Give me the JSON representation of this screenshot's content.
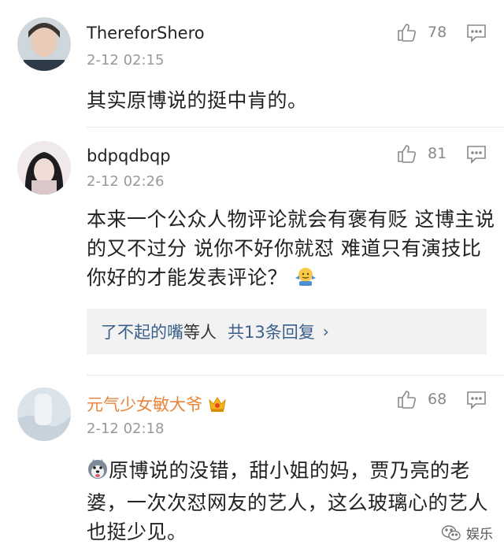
{
  "comments": [
    {
      "username": "ThereforShero",
      "time": "2-12 02:15",
      "likes": "78",
      "text": "其实原博说的挺中肯的。"
    },
    {
      "username": "bdpqdbqp",
      "time": "2-12 02:26",
      "likes": "81",
      "text": "本来一个公众人物评论就会有褒有贬 这博主说的又不过分 说你不好你就怼 难道只有演技比你好的才能发表评论？",
      "replies": {
        "user": "了不起的嘴",
        "mid": "等人",
        "count": "共13条回复",
        "chevron": "›"
      }
    },
    {
      "username": "元气少女敏大爷",
      "time": "2-12 02:18",
      "likes": "68",
      "text": "原博说的没错，甜小姐的妈，贾乃亮的老婆，一次次怼网友的艺人，这么玻璃心的艺人也挺少见。"
    }
  ],
  "watermark": "娱乐",
  "colors": {
    "vip_name": "#e8843c",
    "reply_link": "#3a5f8a",
    "meta": "#999999"
  },
  "icons": [
    "thumbs-up-icon",
    "comment-reply-icon",
    "crown-badge-icon",
    "shrug-emoji-icon",
    "husky-emoji-icon",
    "wechat-icon"
  ]
}
